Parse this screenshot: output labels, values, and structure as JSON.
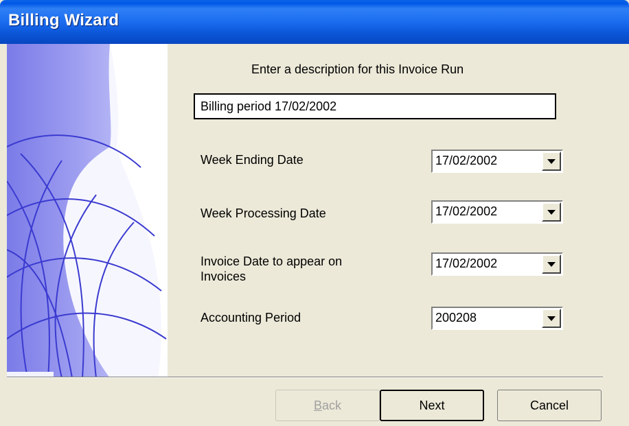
{
  "window": {
    "title": "Billing Wizard"
  },
  "prompt": "Enter a description for this Invoice Run",
  "description": {
    "value": "Billing period 17/02/2002"
  },
  "fields": {
    "week_ending": {
      "label": "Week Ending Date",
      "value": "17/02/2002"
    },
    "week_processing": {
      "label": "Week Processing Date",
      "value": "17/02/2002"
    },
    "invoice_date": {
      "label_line1": "Invoice Date to appear on",
      "label_line2": "Invoices",
      "value": "17/02/2002"
    },
    "accounting_period": {
      "label": "Accounting Period",
      "value": "200208"
    }
  },
  "buttons": {
    "back_mnemonic": "B",
    "back_rest": "ack",
    "next": "Next",
    "cancel": "Cancel"
  },
  "colors": {
    "titlebar": "#0b56d9",
    "face": "#ece9d8",
    "art": "#8f8fee"
  }
}
